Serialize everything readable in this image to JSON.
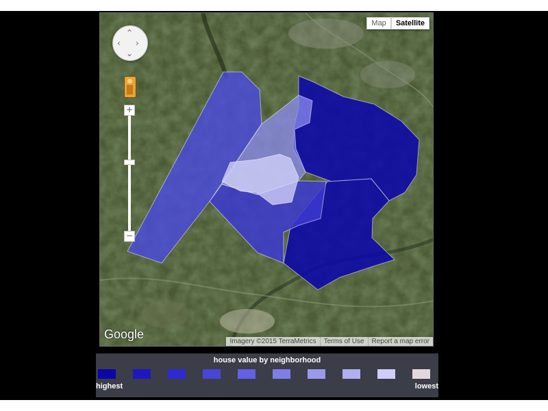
{
  "map": {
    "type_buttons": [
      {
        "label": "Map",
        "active": false
      },
      {
        "label": "Satellite",
        "active": true
      }
    ],
    "controls": {
      "pan_icon": "pan-control-icon",
      "pegman_icon": "street-view-pegman-icon",
      "zoom_in_label": "+",
      "zoom_out_label": "−"
    },
    "logo": "Google",
    "attribution": {
      "imagery": "Imagery ©2015 TerraMetrics",
      "terms": "Terms of Use",
      "report": "Report a map error"
    }
  },
  "legend": {
    "title": "house value by neighborhood",
    "high_label": "highest",
    "low_label": "lowest",
    "colors": [
      "#0a06a8",
      "#1f16c0",
      "#2e2ad3",
      "#4945d8",
      "#6261e3",
      "#7f7de6",
      "#9b99ec",
      "#b0aff0",
      "#cfcef8",
      "#e2d8dc"
    ]
  }
}
